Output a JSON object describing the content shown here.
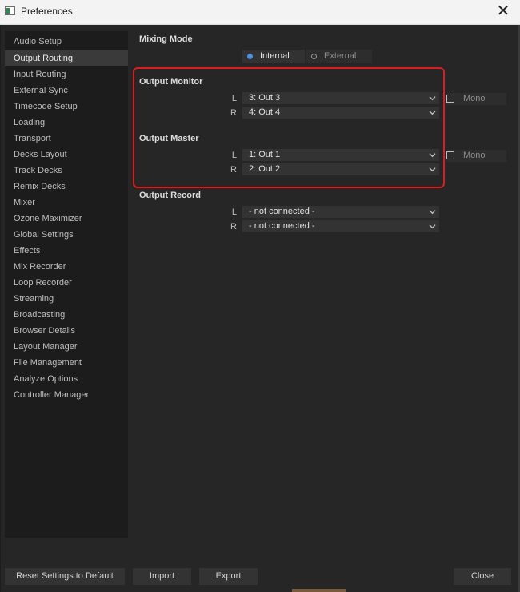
{
  "window": {
    "title": "Preferences",
    "close_glyph": "✕"
  },
  "sidebar": {
    "items": [
      {
        "label": "Audio Setup",
        "selected": false
      },
      {
        "label": "Output Routing",
        "selected": true
      },
      {
        "label": "Input Routing",
        "selected": false
      },
      {
        "label": "External Sync",
        "selected": false
      },
      {
        "label": "Timecode Setup",
        "selected": false
      },
      {
        "label": "Loading",
        "selected": false
      },
      {
        "label": "Transport",
        "selected": false
      },
      {
        "label": "Decks Layout",
        "selected": false
      },
      {
        "label": "Track Decks",
        "selected": false
      },
      {
        "label": "Remix Decks",
        "selected": false
      },
      {
        "label": "Mixer",
        "selected": false
      },
      {
        "label": "Ozone Maximizer",
        "selected": false
      },
      {
        "label": "Global Settings",
        "selected": false
      },
      {
        "label": "Effects",
        "selected": false
      },
      {
        "label": "Mix Recorder",
        "selected": false
      },
      {
        "label": "Loop Recorder",
        "selected": false
      },
      {
        "label": "Streaming",
        "selected": false
      },
      {
        "label": "Broadcasting",
        "selected": false
      },
      {
        "label": "Browser Details",
        "selected": false
      },
      {
        "label": "Layout Manager",
        "selected": false
      },
      {
        "label": "File Management",
        "selected": false
      },
      {
        "label": "Analyze Options",
        "selected": false
      },
      {
        "label": "Controller Manager",
        "selected": false
      }
    ]
  },
  "mixing_mode": {
    "title": "Mixing Mode",
    "options": [
      {
        "label": "Internal",
        "selected": true
      },
      {
        "label": "External",
        "selected": false
      }
    ]
  },
  "output_monitor": {
    "title": "Output Monitor",
    "left_label": "L",
    "left_value": "3: Out 3",
    "right_label": "R",
    "right_value": "4: Out 4",
    "mono_label": "Mono",
    "mono_checked": false
  },
  "output_master": {
    "title": "Output Master",
    "left_label": "L",
    "left_value": "1: Out 1",
    "right_label": "R",
    "right_value": "2: Out 2",
    "mono_label": "Mono",
    "mono_checked": false
  },
  "output_record": {
    "title": "Output Record",
    "left_label": "L",
    "left_value": "- not connected -",
    "right_label": "R",
    "right_value": "- not connected -"
  },
  "footer": {
    "reset_label": "Reset Settings to Default",
    "import_label": "Import",
    "export_label": "Export",
    "close_label": "Close"
  },
  "colors": {
    "accent": "#4a8fe2",
    "highlight_border": "#d81e1e",
    "selected_item": "#3a3a3a"
  }
}
